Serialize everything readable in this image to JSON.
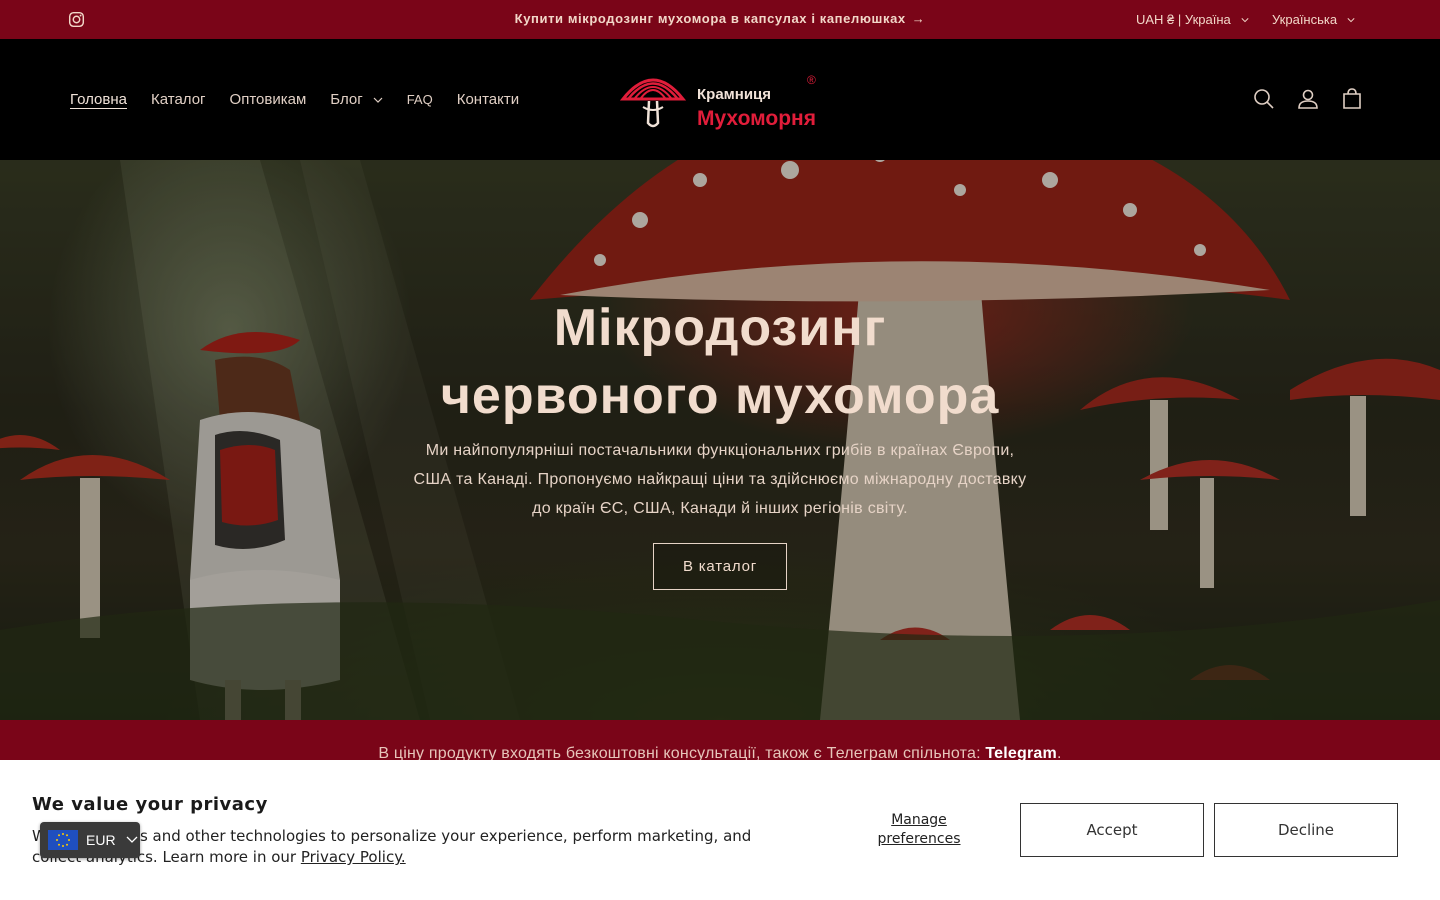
{
  "announcement": {
    "message": "Купити мікродозинг мухомора в капсулах і капелюшках",
    "arrow": "→",
    "currency": "UAH ₴ | Україна",
    "language": "Українська",
    "icons": [
      "instagram-icon",
      "arrow-right-icon",
      "chevron-down-icon"
    ]
  },
  "header": {
    "nav": [
      {
        "label": "Головна"
      },
      {
        "label": "Каталог"
      },
      {
        "label": "Оптовикам"
      },
      {
        "label": "Блог"
      },
      {
        "label": "FAQ"
      },
      {
        "label": "Контакти"
      }
    ],
    "logo": {
      "line1": "Крамниця",
      "line2": "Мухоморня",
      "reg": "®"
    },
    "icons": [
      "search-icon",
      "account-icon",
      "cart-icon"
    ]
  },
  "hero": {
    "title_line1": "Мікродозинг",
    "title_line2": "червоного мухомора",
    "subtitle": "Ми найпопулярніші постачальники функціональних грибів в країнах Європи, США та Канаді. Пропонуємо найкращі ціни та здійснюємо міжнародну доставку до країн ЄС, США, Канади й інших регіонів світу.",
    "button": "В каталог"
  },
  "strip": {
    "text": "В ціну продукту входять безкоштовні консультації, також є Телеграм спільнота: ",
    "link": "Telegram",
    "end": "."
  },
  "cookie": {
    "title": "We value your privacy",
    "body": "We use cookies and other technologies to personalize your experience, perform marketing, and collect analytics. Learn more in our ",
    "link": "Privacy Policy.",
    "manage": "Manage preferences",
    "accept": "Accept",
    "decline": "Decline"
  },
  "currency_widget": {
    "currency": "EUR"
  },
  "colors": {
    "brand_red": "#7a0518",
    "logo_red": "#e11d3a",
    "header_bg": "#000000"
  }
}
